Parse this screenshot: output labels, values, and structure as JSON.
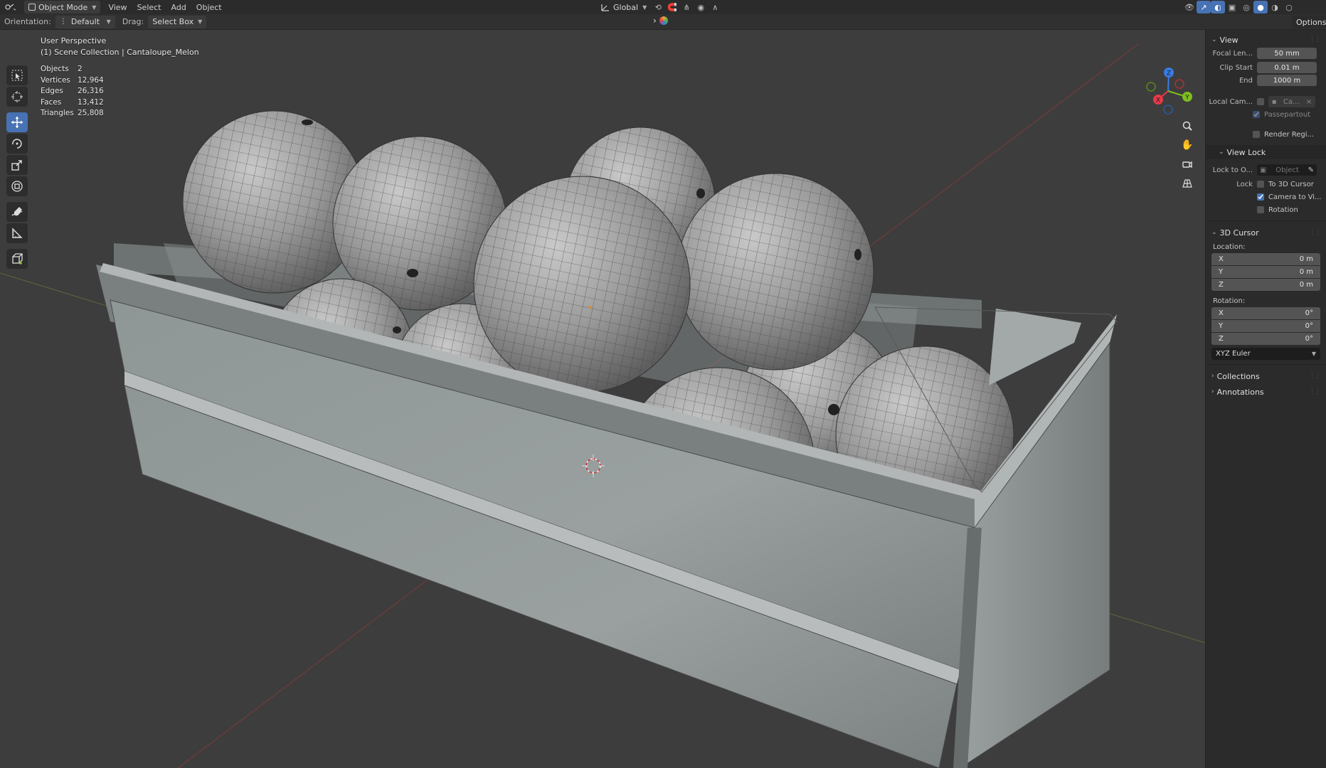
{
  "header": {
    "mode": "Object Mode",
    "menus": [
      "View",
      "Select",
      "Add",
      "Object"
    ],
    "transform_orientation": "Global"
  },
  "toolsettings": {
    "orientation_label": "Orientation:",
    "orientation_value": "Default",
    "drag_label": "Drag:",
    "drag_value": "Select Box",
    "options_label": "Options"
  },
  "viewport": {
    "view_name": "User Perspective",
    "collection": "(1) Scene Collection | Cantaloupe_Melon",
    "stats": [
      {
        "label": "Objects",
        "value": "2"
      },
      {
        "label": "Vertices",
        "value": "12,964"
      },
      {
        "label": "Edges",
        "value": "26,316"
      },
      {
        "label": "Faces",
        "value": "13,412"
      },
      {
        "label": "Triangles",
        "value": "25,808"
      }
    ],
    "gizmo": {
      "z": "Z",
      "y": "Y",
      "x": "X"
    }
  },
  "npanel": {
    "view": {
      "title": "View",
      "focal_label": "Focal Len...",
      "focal_value": "50 mm",
      "clip_start_label": "Clip Start",
      "clip_start_value": "0.01 m",
      "clip_end_label": "End",
      "clip_end_value": "1000 m",
      "local_cam_label": "Local Cam...",
      "local_cam_value": "Ca...",
      "passepartout": "Passepartout",
      "render_region": "Render Regi..."
    },
    "view_lock": {
      "title": "View Lock",
      "lock_to_label": "Lock to O...",
      "lock_to_value": "Object",
      "lock_label": "Lock",
      "to_3d_cursor": "To 3D Cursor",
      "camera_to_view": "Camera to Vi...",
      "rotation": "Rotation"
    },
    "cursor": {
      "title": "3D Cursor",
      "location_label": "Location:",
      "location": [
        {
          "axis": "X",
          "value": "0 m"
        },
        {
          "axis": "Y",
          "value": "0 m"
        },
        {
          "axis": "Z",
          "value": "0 m"
        }
      ],
      "rotation_label": "Rotation:",
      "rotation": [
        {
          "axis": "X",
          "value": "0°"
        },
        {
          "axis": "Y",
          "value": "0°"
        },
        {
          "axis": "Z",
          "value": "0°"
        }
      ],
      "rotation_mode": "XYZ Euler"
    },
    "collections_title": "Collections",
    "annotations_title": "Annotations"
  },
  "colors": {
    "accent": "#4772b3",
    "axis_x": "#e63a4a",
    "axis_y": "#7fbf1f",
    "axis_z": "#3a7be6"
  }
}
